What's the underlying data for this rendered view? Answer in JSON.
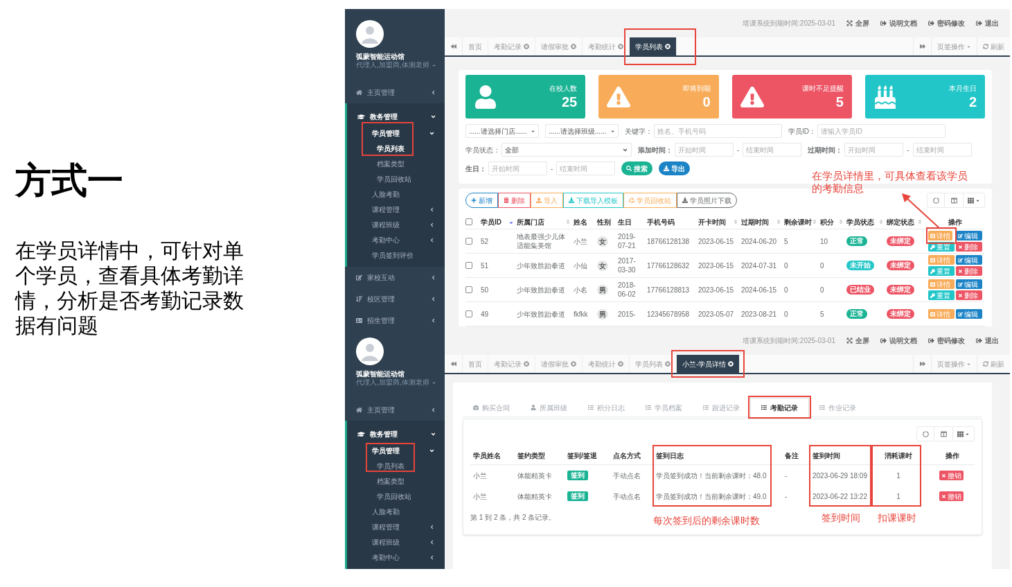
{
  "slide": {
    "title": "方式一",
    "body": "在学员详情中，可针对单个学员，查看具体考勤详情，分析是否考勤记录数据有问题"
  },
  "screens": [
    {
      "kind": "list",
      "sidebar": {
        "brand": "弧蒙智能运动馆",
        "role": "代理人,加盟商,体测老师",
        "menu": [
          {
            "label": "主页管理",
            "expanded": false
          },
          {
            "label": "教务管理",
            "expanded": true,
            "children": [
              {
                "label": "学员管理",
                "expanded": true,
                "children": [
                  {
                    "label": "学员列表",
                    "selected": true
                  },
                  {
                    "label": "档案类型",
                    "selected": false
                  },
                  {
                    "label": "学员回收站",
                    "selected": false
                  }
                ]
              },
              {
                "label": "人脸考勤",
                "selected": false
              },
              {
                "label": "课程管理",
                "expanded": false
              },
              {
                "label": "课程班级",
                "expanded": false
              },
              {
                "label": "考勤中心",
                "expanded": false
              },
              {
                "label": "学员签到评价",
                "selected": false
              }
            ]
          },
          {
            "label": "家校互动",
            "expanded": false
          },
          {
            "label": "校区管理",
            "expanded": false
          },
          {
            "label": "招生管理",
            "expanded": false
          }
        ]
      },
      "header": {
        "expiry": "塔课系统到期时间:2025-03-01",
        "links": [
          "全屏",
          "说明文档",
          "密码修改",
          "退出"
        ]
      },
      "tabs": {
        "items": [
          {
            "label": "首页",
            "closable": false,
            "selected": false
          },
          {
            "label": "考勤记录",
            "closable": true,
            "selected": false
          },
          {
            "label": "请假审批",
            "closable": true,
            "selected": false
          },
          {
            "label": "考勤统计",
            "closable": true,
            "selected": false
          },
          {
            "label": "学员列表",
            "closable": true,
            "selected": true
          }
        ],
        "actions": [
          "页签操作",
          "刷新"
        ]
      },
      "stats": [
        {
          "label": "在校人数",
          "value": "25",
          "color": "#1ab394"
        },
        {
          "label": "即将到期",
          "value": "0",
          "color": "#f8ac59"
        },
        {
          "label": "课时不足提醒",
          "value": "5",
          "color": "#ed5565"
        },
        {
          "label": "本月生日",
          "value": "2",
          "color": "#23c6c8"
        }
      ],
      "filters": [
        [
          {
            "kind": "select",
            "value": "......请选择门店......"
          },
          {
            "kind": "select",
            "value": "......请选择班级......"
          },
          {
            "kind": "field",
            "label": "关键字：",
            "bold": false,
            "placeholder": "姓名、手机号码"
          },
          {
            "kind": "field",
            "label": "学员ID：",
            "bold": false,
            "placeholder": "请输入学员ID"
          }
        ],
        [
          {
            "kind": "select",
            "label": "学员状态：",
            "bold": false,
            "value": "全部"
          },
          {
            "kind": "range",
            "label": "添加时间：",
            "bold": true,
            "fields": [
              {
                "placeholder": "开始时间"
              },
              {
                "placeholder": "结束时间"
              }
            ],
            "separator": "-"
          },
          {
            "kind": "range",
            "label": "过期时间：",
            "bold": true,
            "fields": [
              {
                "placeholder": "开始时间"
              },
              {
                "placeholder": "结束时间"
              }
            ],
            "separator": "-"
          }
        ],
        [
          {
            "kind": "range",
            "label": "生日：",
            "bold": true,
            "fields": [
              {
                "placeholder": "开始时间"
              },
              {
                "placeholder": "结束时间"
              }
            ],
            "separator": "-"
          },
          {
            "kind": "button",
            "label": "搜索",
            "color": "#1ab394"
          },
          {
            "kind": "button",
            "label": "导出",
            "color": "#1c84c6"
          }
        ]
      ],
      "toolbar": [
        {
          "label": "新增",
          "color": "#1c84c6"
        },
        {
          "label": "删除",
          "color": "#ed5565"
        },
        {
          "label": "导入",
          "color": "#f8ac59"
        },
        {
          "label": "下载导入模板",
          "color": "#23c6c8"
        },
        {
          "label": "学员回收站",
          "color": "#f8ac59"
        },
        {
          "label": "学员照片下载",
          "color": "#676a6c"
        }
      ],
      "table": {
        "all_checked": false,
        "columns": [
          {
            "label": "学员ID",
            "sortable": true,
            "sorted": true
          },
          {
            "label": "所属门店",
            "sortable": true,
            "sorted": false
          },
          {
            "label": "姓名",
            "sortable": false
          },
          {
            "label": "性别",
            "sortable": false
          },
          {
            "label": "生日",
            "sortable": false
          },
          {
            "label": "手机号码",
            "sortable": false
          },
          {
            "label": "开卡时间",
            "sortable": true,
            "sorted": false
          },
          {
            "label": "过期时间",
            "sortable": true,
            "sorted": false
          },
          {
            "label": "剩余课时",
            "sortable": true,
            "sorted": false
          },
          {
            "label": "积分",
            "sortable": true,
            "sorted": false
          },
          {
            "label": "学员状态",
            "sortable": true,
            "sorted": false
          },
          {
            "label": "绑定状态",
            "sortable": true,
            "sorted": false
          },
          {
            "label": "操作",
            "sortable": false
          }
        ],
        "rows": [
          {
            "checked": false,
            "id": "52",
            "store": "地表最强少儿体适能集美馆",
            "name": "小兰",
            "gender": "女",
            "birthday": "2019-07-21",
            "phone": "18766128138",
            "opened": "2023-06-15",
            "expires": "2024-06-20",
            "hours": "5",
            "points": "10",
            "status": {
              "text": "正常",
              "color": "#1ab394"
            },
            "binding": {
              "text": "未绑定",
              "color": "#ed5565"
            },
            "actions": [
              {
                "label": "详情",
                "color": "#f8ac59"
              },
              {
                "label": "编辑",
                "color": "#1c84c6"
              },
              {
                "label": "重置",
                "color": "#23c6c8"
              },
              {
                "label": "删除",
                "color": "#ed5565"
              }
            ]
          },
          {
            "checked": false,
            "id": "51",
            "store": "少年致胜跆拳道",
            "name": "小仙",
            "gender": "女",
            "birthday": "2017-03-30",
            "phone": "17766128632",
            "opened": "2023-06-15",
            "expires": "2024-07-31",
            "hours": "0",
            "points": "0",
            "status": {
              "text": "未开始",
              "color": "#23c6c8"
            },
            "binding": {
              "text": "未绑定",
              "color": "#ed5565"
            },
            "actions": [
              {
                "label": "详情",
                "color": "#f8ac59"
              },
              {
                "label": "编辑",
                "color": "#1c84c6"
              },
              {
                "label": "重置",
                "color": "#23c6c8"
              },
              {
                "label": "删除",
                "color": "#ed5565"
              }
            ]
          },
          {
            "checked": false,
            "id": "50",
            "store": "少年致胜跆拳道",
            "name": "小名",
            "gender": "男",
            "birthday": "2018-06-02",
            "phone": "17766128813",
            "opened": "2023-06-15",
            "expires": "2024-06-15",
            "hours": "0",
            "points": "0",
            "status": {
              "text": "已结业",
              "color": "#ed5565"
            },
            "binding": {
              "text": "未绑定",
              "color": "#ed5565"
            },
            "actions": [
              {
                "label": "详情",
                "color": "#f8ac59"
              },
              {
                "label": "编辑",
                "color": "#1c84c6"
              },
              {
                "label": "重置",
                "color": "#23c6c8"
              },
              {
                "label": "删除",
                "color": "#ed5565"
              }
            ]
          },
          {
            "checked": false,
            "id": "49",
            "store": "少年致胜跆拳道",
            "name": "fkfkk",
            "gender": "男",
            "birthday": "2015-",
            "phone": "12345678958",
            "opened": "2023-05-07",
            "expires": "2023-08-21",
            "hours": "0",
            "points": "5",
            "status": {
              "text": "正常",
              "color": "#1ab394"
            },
            "binding": {
              "text": "未绑定",
              "color": "#ed5565"
            },
            "actions": [
              {
                "label": "详情",
                "color": "#f8ac59"
              },
              {
                "label": "编辑",
                "color": "#1c84c6"
              }
            ]
          }
        ]
      },
      "note": "在学员详情里，可具体查看该学员的考勤信息"
    },
    {
      "kind": "detail",
      "sidebar": {
        "brand": "弧蒙智能运动馆",
        "role": "代理人,加盟商,体测老师",
        "menu": [
          {
            "label": "主页管理",
            "expanded": false
          },
          {
            "label": "教务管理",
            "expanded": true,
            "children": [
              {
                "label": "学员管理",
                "expanded": true,
                "children": [
                  {
                    "label": "学员列表",
                    "selected": false
                  },
                  {
                    "label": "档案类型",
                    "selected": false
                  },
                  {
                    "label": "学员回收站",
                    "selected": false
                  }
                ]
              },
              {
                "label": "人脸考勤",
                "selected": false
              },
              {
                "label": "课程管理",
                "expanded": false
              },
              {
                "label": "课程班级",
                "expanded": false
              },
              {
                "label": "考勤中心",
                "expanded": false
              }
            ]
          }
        ]
      },
      "header": {
        "expiry": "塔课系统到期时间:2025-03-01",
        "links": [
          "全屏",
          "说明文档",
          "密码修改",
          "退出"
        ]
      },
      "tabs": {
        "items": [
          {
            "label": "首页",
            "closable": false,
            "selected": false
          },
          {
            "label": "考勤记录",
            "closable": true,
            "selected": false
          },
          {
            "label": "请假审批",
            "closable": true,
            "selected": false
          },
          {
            "label": "考勤统计",
            "closable": true,
            "selected": false
          },
          {
            "label": "学员列表",
            "closable": true,
            "selected": false
          },
          {
            "label": "小兰-学员详情",
            "closable": true,
            "selected": true
          }
        ],
        "actions": [
          "页签操作",
          "刷新"
        ]
      },
      "subtabs": [
        {
          "label": "购买合同",
          "selected": false
        },
        {
          "label": "所属班级",
          "selected": false
        },
        {
          "label": "积分日志",
          "selected": false
        },
        {
          "label": "学员档案",
          "selected": false
        },
        {
          "label": "跟进记录",
          "selected": false
        },
        {
          "label": "考勤记录",
          "selected": true
        },
        {
          "label": "作业记录",
          "selected": false
        }
      ],
      "records": {
        "columns": [
          "学员姓名",
          "签约类型",
          "签到/签退",
          "点名方式",
          "签到日志",
          "备注",
          "签到时间",
          "消耗课时",
          "操作"
        ],
        "rows": [
          {
            "name": "小兰",
            "card": "体能精英卡",
            "sign": {
              "text": "签到",
              "color": "#1ab394"
            },
            "method": "手动点名",
            "log": "学员签到成功！当前剩余课时：48.0",
            "remark": "-",
            "time": "2023-06-29 18:09",
            "hours": "1",
            "action": "撤销"
          },
          {
            "name": "小兰",
            "card": "体能精英卡",
            "sign": {
              "text": "签到",
              "color": "#1ab394"
            },
            "method": "手动点名",
            "log": "学员签到成功！当前剩余课时：49.0",
            "remark": "-",
            "time": "2023-06-22 13:22",
            "hours": "1",
            "action": "撤销"
          }
        ],
        "footer": "第 1 到 2 条，共 2 条记录。"
      },
      "notes": [
        "每次签到后的剩余课时数",
        "签到时间",
        "扣课课时"
      ]
    }
  ]
}
